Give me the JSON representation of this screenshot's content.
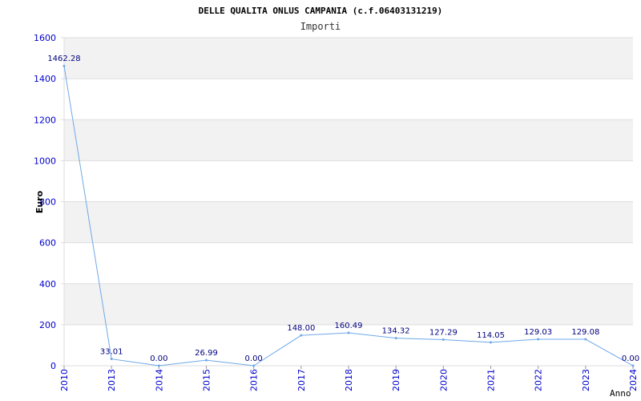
{
  "chart_data": {
    "type": "line",
    "title": "DELLE QUALITA ONLUS CAMPANIA (c.f.06403131219)",
    "subtitle": "Importi",
    "xlabel": "Anno",
    "ylabel": "Euro",
    "categories": [
      "2010",
      "2013",
      "2014",
      "2015",
      "2016",
      "2017",
      "2018",
      "2019",
      "2020",
      "2021",
      "2022",
      "2023",
      "2024"
    ],
    "series": [
      {
        "values": [
          1462.28,
          33.01,
          0.0,
          26.99,
          0.0,
          148.0,
          160.49,
          134.32,
          127.29,
          114.05,
          129.03,
          129.08,
          0.0
        ]
      }
    ],
    "data_labels": [
      "1462.28",
      "33.01",
      "0.00",
      "26.99",
      "0.00",
      "148.00",
      "160.49",
      "134.32",
      "127.29",
      "114.05",
      "129.03",
      "129.08",
      "0.00"
    ],
    "ylim": [
      0,
      1600
    ],
    "yticks": [
      0,
      200,
      400,
      600,
      800,
      1000,
      1200,
      1400,
      1600
    ],
    "grid": true,
    "colors": {
      "line": "#6fa8e8",
      "band": "#f2f2f2",
      "gridline": "#dddddd",
      "tick_text": "#0000cc",
      "label_text": "#000080"
    }
  }
}
